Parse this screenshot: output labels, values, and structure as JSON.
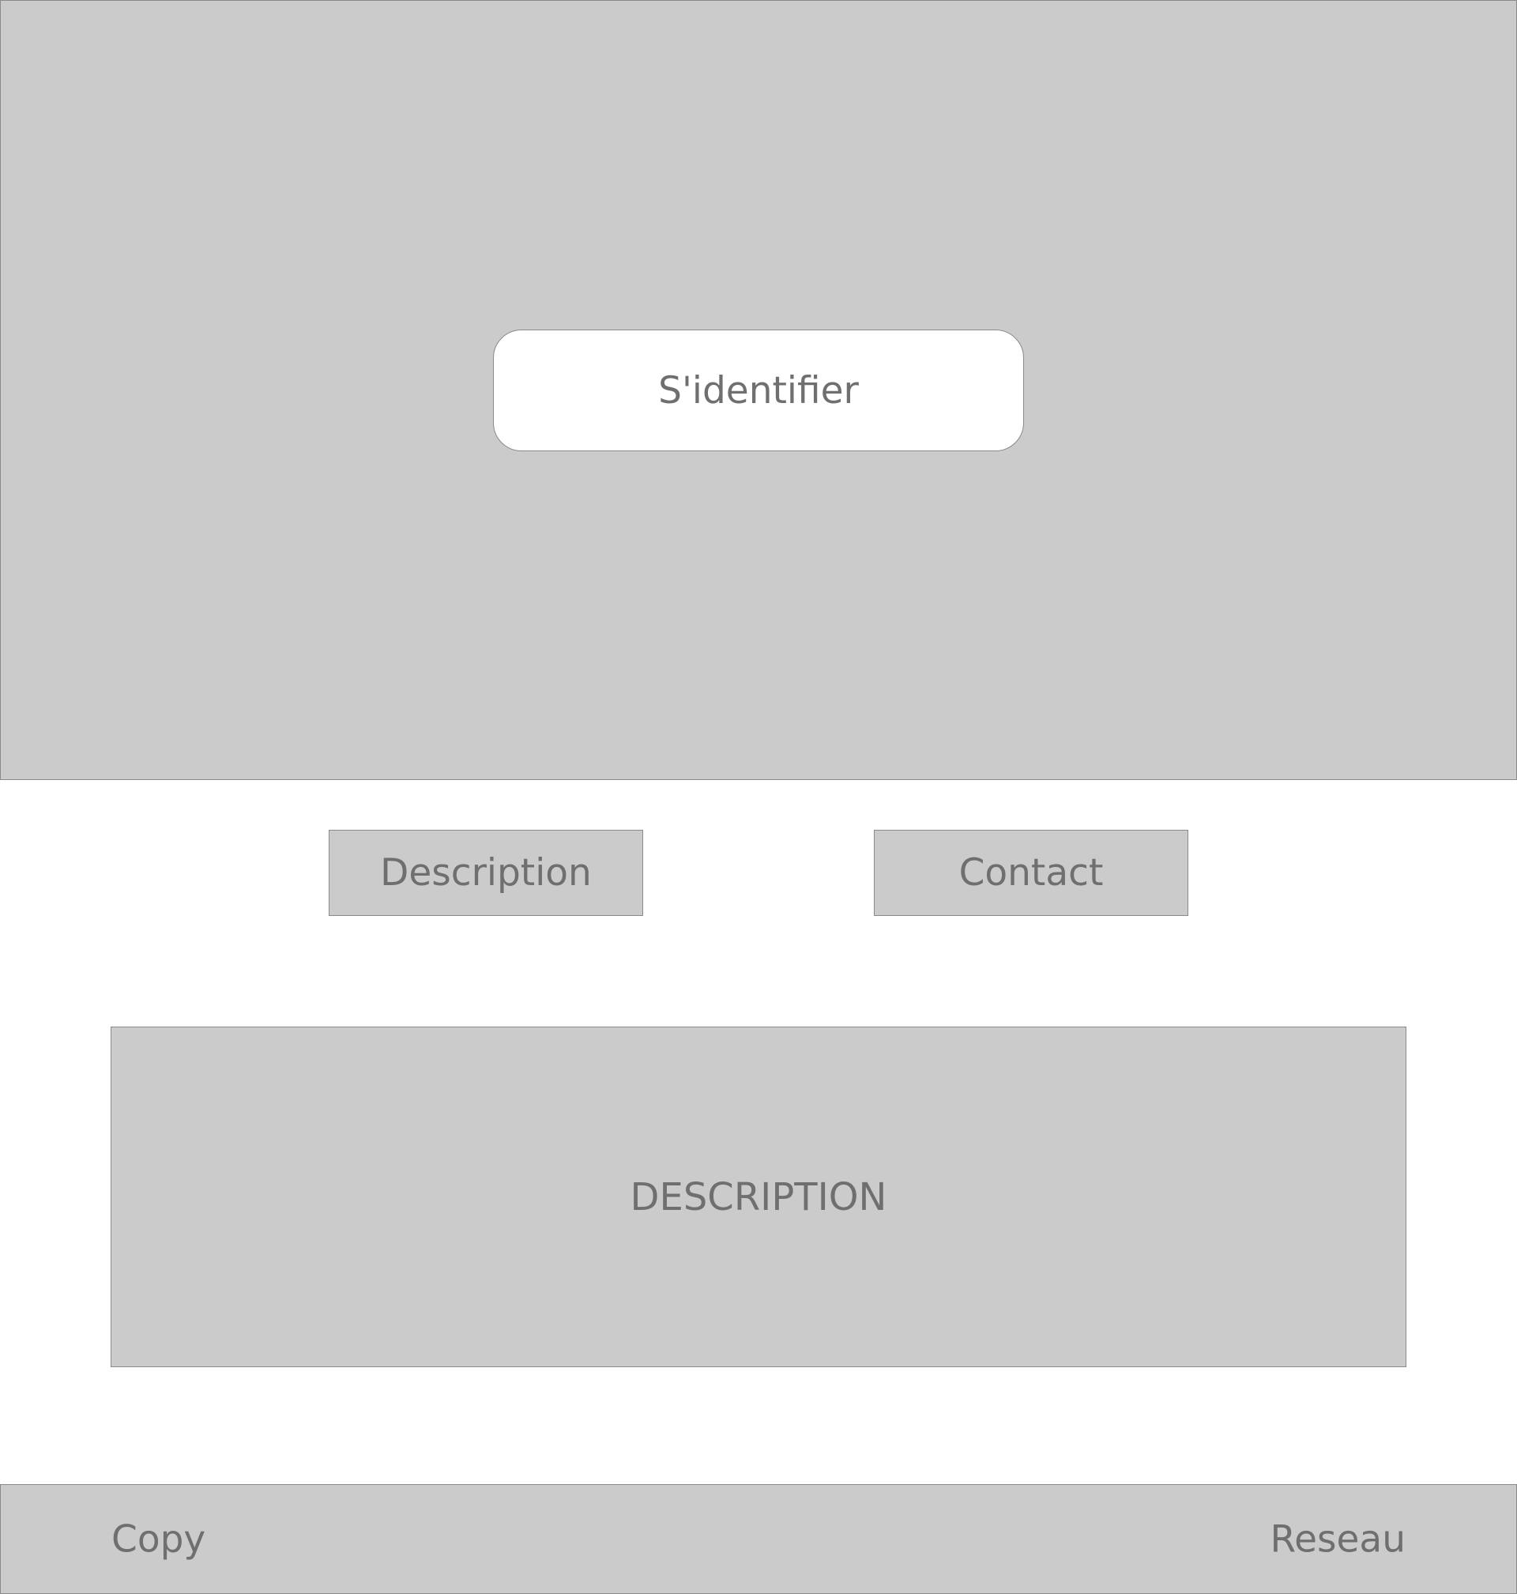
{
  "hero": {
    "login_button_label": "S'identifier"
  },
  "nav": {
    "description_label": "Description",
    "contact_label": "Contact"
  },
  "description_panel": {
    "text": "DESCRIPTION"
  },
  "footer": {
    "copy_label": "Copy",
    "reseau_label": "Reseau"
  },
  "colors": {
    "block_fill": "#cbcbcb",
    "border": "#8a8a8a",
    "text": "#6f6f6f",
    "background": "#ffffff"
  }
}
